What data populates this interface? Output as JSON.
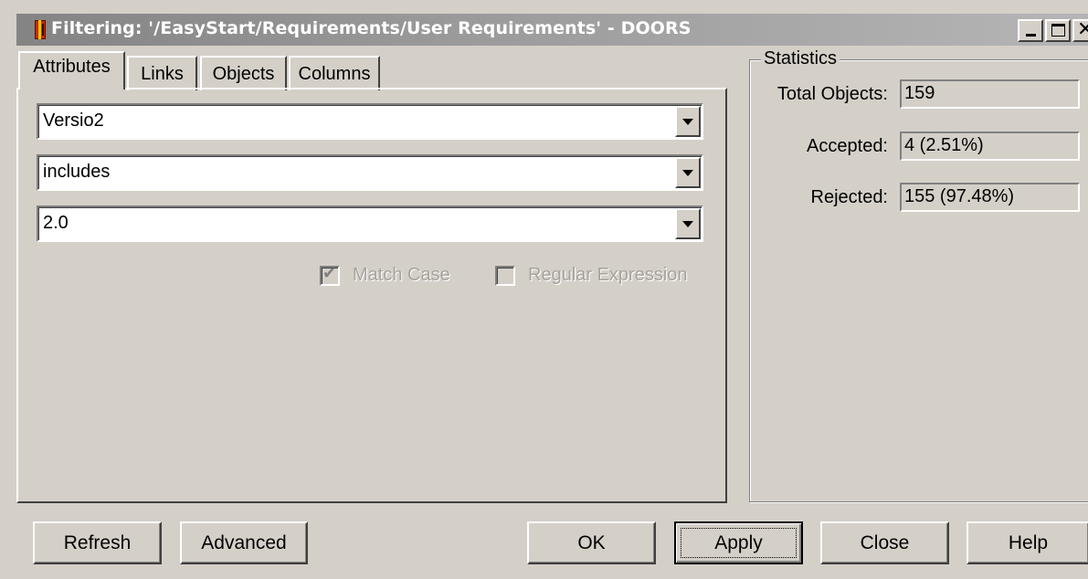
{
  "window": {
    "title": "Filtering: '/EasyStart/Requirements/User Requirements' - DOORS",
    "app_icon": "doors-app-icon",
    "controls": {
      "minimize": "minimize-icon",
      "maximize": "maximize-icon",
      "close": "close-icon",
      "close_glyph": "✕"
    }
  },
  "tabs": [
    {
      "label": "Attributes",
      "active": true
    },
    {
      "label": "Links",
      "active": false
    },
    {
      "label": "Objects",
      "active": false
    },
    {
      "label": "Columns",
      "active": false
    }
  ],
  "filter": {
    "attribute": "Versio2",
    "condition": "includes",
    "value": "2.0",
    "match_case": {
      "label": "Match Case",
      "checked": true,
      "enabled": false,
      "mark": "✔"
    },
    "regular_expression": {
      "label": "Regular Expression",
      "checked": false,
      "enabled": false
    }
  },
  "statistics": {
    "title": "Statistics",
    "total_label": "Total Objects:",
    "total_value": "159",
    "accepted_label": "Accepted:",
    "accepted_value": "4 (2.51%)",
    "rejected_label": "Rejected:",
    "rejected_value": "155 (97.48%)"
  },
  "buttons": {
    "refresh": "Refresh",
    "advanced": "Advanced",
    "ok": "OK",
    "apply": "Apply",
    "close": "Close",
    "help": "Help"
  },
  "colors": {
    "dialog_bg": "#d4d0c8",
    "titlebar_inactive": "#9c9c9c",
    "disabled_text": "#a6a39c"
  }
}
